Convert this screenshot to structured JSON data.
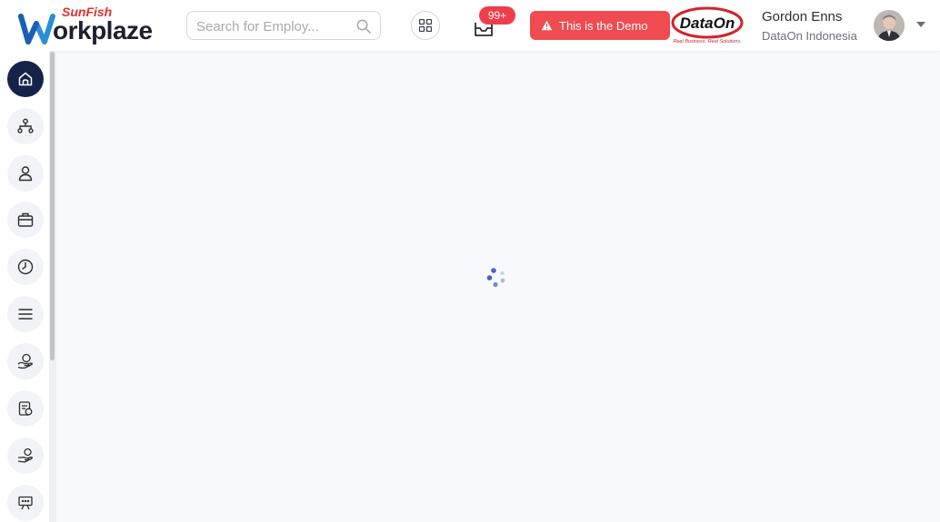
{
  "header": {
    "logo_top": "SunFish",
    "logo_word": "orkplaze",
    "search_placeholder": "Search for Employ...",
    "notification_count": "99+",
    "demo_banner": "This is the Demo",
    "brand_logo": "DataOn",
    "brand_tagline": "Real Business. Real Solutions.",
    "user_name": "Gordon Enns",
    "user_org": "DataOn Indonesia"
  },
  "sidebar": {
    "items": [
      {
        "icon": "home-icon",
        "active": true
      },
      {
        "icon": "org-chart-icon",
        "active": false
      },
      {
        "icon": "person-icon",
        "active": false
      },
      {
        "icon": "briefcase-icon",
        "active": false
      },
      {
        "icon": "clock-icon",
        "active": false
      },
      {
        "icon": "menu-icon",
        "active": false
      },
      {
        "icon": "hand-coins-icon",
        "active": false
      },
      {
        "icon": "payroll-icon",
        "active": false
      },
      {
        "icon": "hand-money-icon",
        "active": false
      },
      {
        "icon": "training-icon",
        "active": false
      }
    ]
  },
  "colors": {
    "sidebar_active": "#15234a",
    "banner": "#f04b50",
    "badge": "#ef3e4a",
    "spinner": "#3f63c4"
  }
}
